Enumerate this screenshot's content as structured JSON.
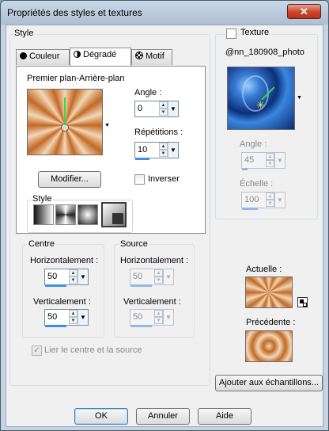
{
  "window": {
    "title": "Propriétés des styles et textures",
    "close_glyph": "✕"
  },
  "style_group": {
    "label": "Style"
  },
  "tabs": [
    {
      "label": "Couleur",
      "icon": "circle-icon"
    },
    {
      "label": "Dégradé",
      "icon": "half-circle-icon"
    },
    {
      "label": "Motif",
      "icon": "pattern-icon"
    }
  ],
  "gradient": {
    "label": "Premier plan-Arrière-plan",
    "angle_label": "Angle :",
    "angle": "0",
    "repeats_label": "Répétitions :",
    "repeats": "10",
    "modify_label": "Modifier...",
    "invert_label": "Inverser",
    "style_label": "Style",
    "colors": {
      "light": "#f2d6b6",
      "dark": "#c26a24"
    }
  },
  "centre": {
    "label": "Centre",
    "h_label": "Horizontalement :",
    "h": "50",
    "v_label": "Verticalement :",
    "v": "50"
  },
  "source": {
    "label": "Source",
    "h_label": "Horizontalement :",
    "h": "50",
    "v_label": "Verticalement :",
    "v": "50"
  },
  "link_label": "Lier le centre et la source",
  "texture": {
    "label": "Texture",
    "name": "@nn_180908_photo",
    "angle_label": "Angle :",
    "angle": "45",
    "scale_label": "Échelle :",
    "scale": "100"
  },
  "current_label": "Actuelle :",
  "previous_label": "Précédente :",
  "add_label": "Ajouter aux échantillons...",
  "buttons": {
    "ok": "OK",
    "cancel": "Annuler",
    "help": "Aide"
  }
}
